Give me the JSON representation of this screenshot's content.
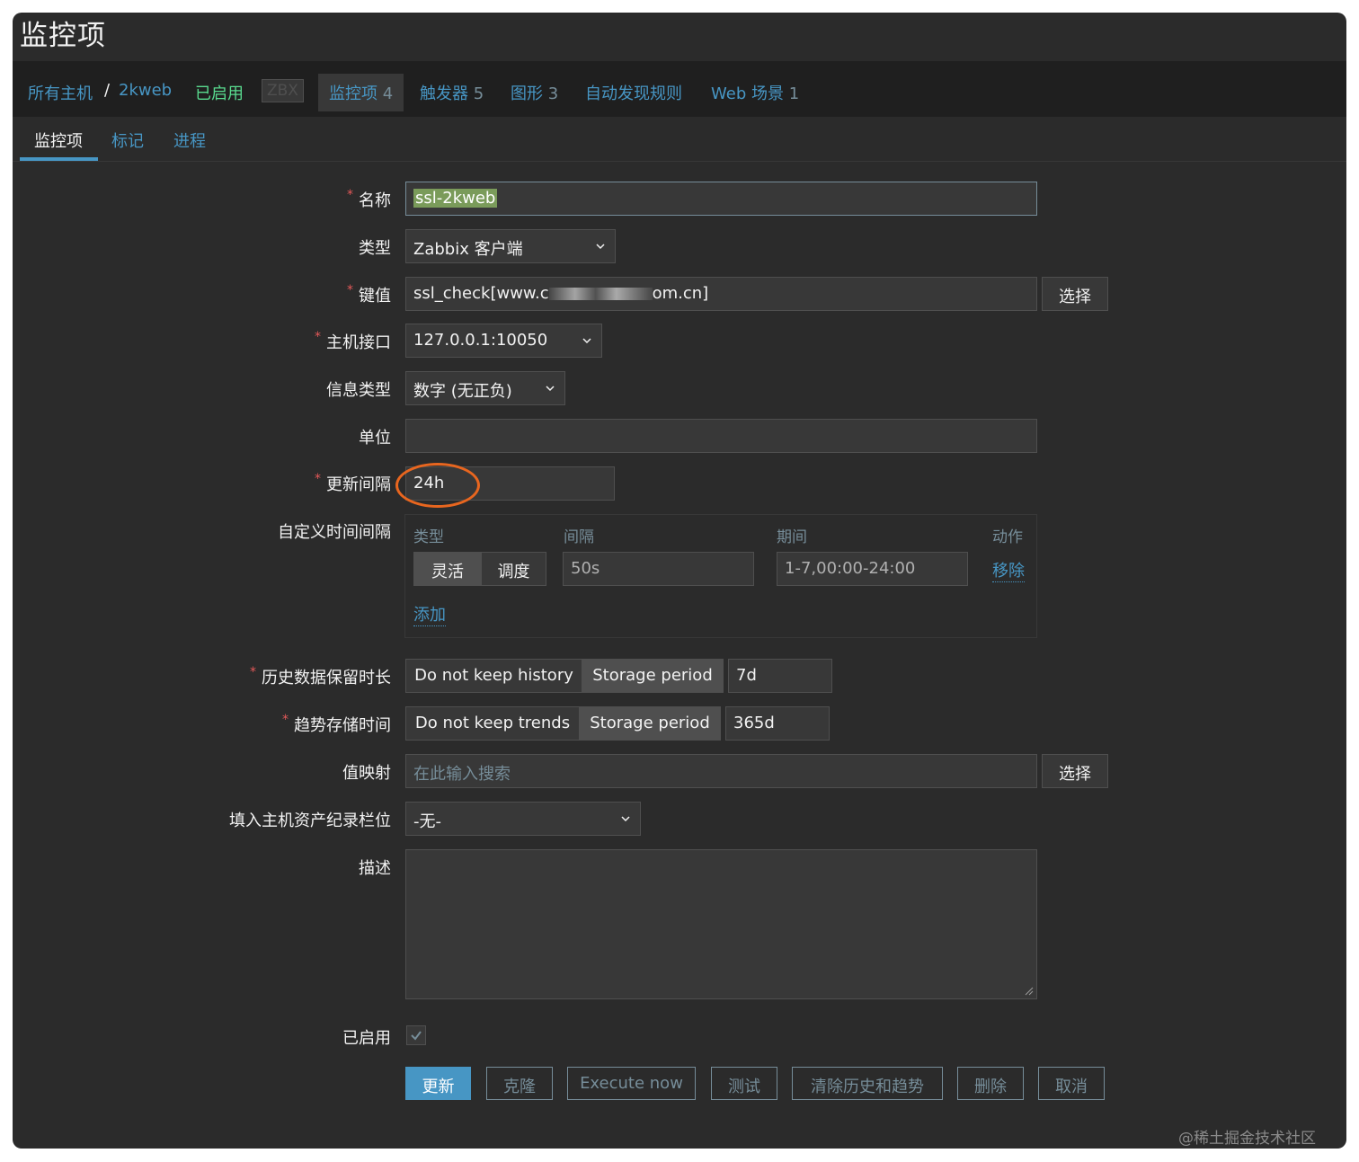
{
  "page_title": "监控项",
  "navbar": {
    "all_hosts": "所有主机",
    "separator": "/",
    "host": "2kweb",
    "enabled": "已启用",
    "zbx": "ZBX",
    "items": {
      "label": "监控项",
      "count": "4"
    },
    "triggers": {
      "label": "触发器",
      "count": "5"
    },
    "graphs": {
      "label": "图形",
      "count": "3"
    },
    "discovery": "自动发现规则",
    "web": {
      "label": "Web 场景",
      "count": "1"
    }
  },
  "tabs": [
    "监控项",
    "标记",
    "进程"
  ],
  "form": {
    "name": {
      "label": "名称",
      "value": "ssl-2kweb"
    },
    "type": {
      "label": "类型",
      "value": "Zabbix 客户端"
    },
    "key": {
      "label": "键值",
      "value_prefix": "ssl_check[www.c",
      "value_suffix": "om.cn]",
      "button": "选择"
    },
    "interface": {
      "label": "主机接口",
      "value": "127.0.0.1:10050"
    },
    "info_type": {
      "label": "信息类型",
      "value": "数字 (无正负)"
    },
    "units": {
      "label": "单位",
      "value": ""
    },
    "update_interval": {
      "label": "更新间隔",
      "value": "24h"
    },
    "custom_intervals": {
      "label": "自定义时间间隔",
      "headers": {
        "type": "类型",
        "interval": "间隔",
        "period": "期间",
        "action": "动作"
      },
      "row": {
        "flexible": "灵活",
        "scheduling": "调度",
        "interval": "50s",
        "period": "1-7,00:00-24:00",
        "remove": "移除"
      },
      "add": "添加"
    },
    "history": {
      "label": "历史数据保留时长",
      "opt_off": "Do not keep history",
      "opt_on": "Storage period",
      "value": "7d"
    },
    "trends": {
      "label": "趋势存储时间",
      "opt_off": "Do not keep trends",
      "opt_on": "Storage period",
      "value": "365d"
    },
    "valuemap": {
      "label": "值映射",
      "placeholder": "在此输入搜索",
      "button": "选择"
    },
    "inventory": {
      "label": "填入主机资产纪录栏位",
      "value": "-无-"
    },
    "description": {
      "label": "描述",
      "value": ""
    },
    "enabled": {
      "label": "已启用",
      "checked": true
    }
  },
  "actions": {
    "update": "更新",
    "clone": "克隆",
    "execute": "Execute now",
    "test": "测试",
    "clear": "清除历史和趋势",
    "delete": "删除",
    "cancel": "取消"
  },
  "watermark": "@稀土掘金技术社区",
  "colors": {
    "accent": "#4796c4",
    "enabled": "#59db8f",
    "required": "#e45959",
    "highlight_ring": "#e8661f"
  }
}
